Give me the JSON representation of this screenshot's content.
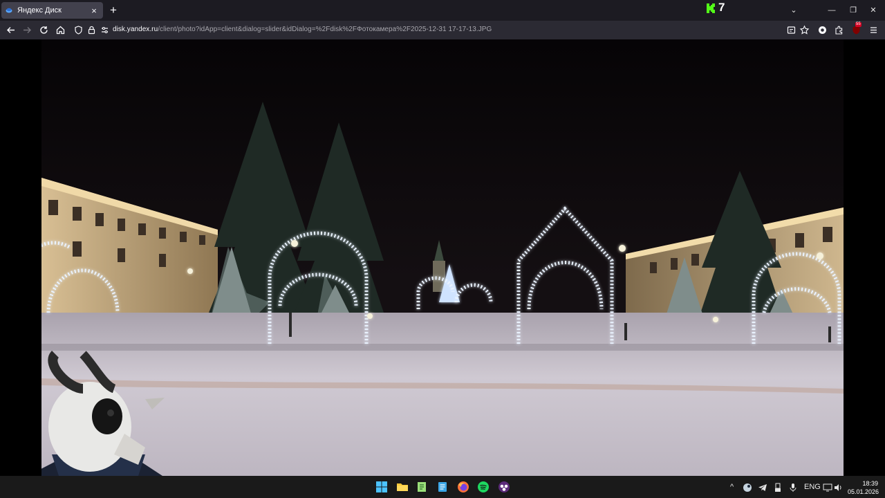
{
  "browser": {
    "tab_title": "Яндекс Диск",
    "tab_close": "×",
    "new_tab": "+",
    "extension_counter": "7",
    "window_buttons": {
      "minimize": "—",
      "restore": "❐",
      "close": "✕",
      "list_tabs": "⌄"
    },
    "url_domain": "disk.yandex.ru",
    "url_path": "/client/photo?idApp=client&dialog=slider&idDialog=%2Fdisk%2FФотокамера%2F2025-12-31 17-17-13.JPG",
    "ext_badge_count": "55"
  },
  "photo": {
    "alt": "2025-12-31 17-17-13.JPG"
  },
  "taskbar": {
    "apps": [
      "windows-start",
      "file-explorer",
      "notepad-plus",
      "notepad",
      "firefox",
      "spotify",
      "obs"
    ],
    "tray": {
      "language": "ENG"
    },
    "clock": {
      "time": "18:39",
      "date": "05.01.2026"
    }
  },
  "colors": {
    "tab_bar": "#1c1b22",
    "active_tab": "#42414d",
    "nav_bar": "#2b2a33",
    "taskbar": "#1a1a1a",
    "accent": "#0a84ff"
  }
}
